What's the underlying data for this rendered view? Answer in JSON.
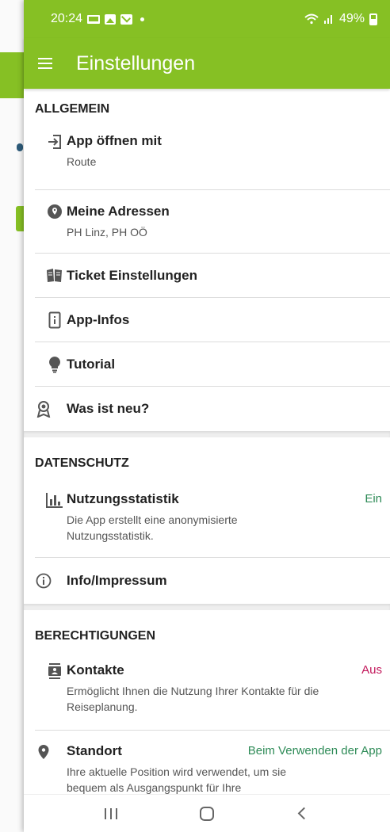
{
  "status_bar": {
    "time": "20:24",
    "battery": "49%"
  },
  "app_bar": {
    "title": "Einstellungen"
  },
  "sections": {
    "allgemein": {
      "header": "ALLGEMEIN",
      "items": [
        {
          "title": "App öffnen mit",
          "subtitle": "Route",
          "icon": "open-in-icon"
        },
        {
          "title": "Meine Adressen",
          "subtitle": "PH Linz, PH OÖ",
          "icon": "location-icon"
        },
        {
          "title": "Ticket Einstellungen",
          "icon": "ticket-icon"
        },
        {
          "title": "App-Infos",
          "icon": "phone-info-icon"
        },
        {
          "title": "Tutorial",
          "icon": "lightbulb-icon"
        },
        {
          "title": "Was ist neu?",
          "icon": "award-icon"
        }
      ]
    },
    "datenschutz": {
      "header": "DATENSCHUTZ",
      "items": [
        {
          "title": "Nutzungsstatistik",
          "value": "Ein",
          "subtitle": "Die App erstellt eine anonymisierte Nutzungsstatistik.",
          "icon": "bar-chart-icon"
        },
        {
          "title": "Info/Impressum",
          "icon": "info-icon"
        }
      ]
    },
    "berechtigungen": {
      "header": "BERECHTIGUNGEN",
      "items": [
        {
          "title": "Kontakte",
          "value": "Aus",
          "subtitle": "Ermöglicht Ihnen die Nutzung Ihrer Kontakte für die Reiseplanung.",
          "icon": "contacts-icon"
        },
        {
          "title": "Standort",
          "value": "Beim Verwenden der App",
          "subtitle": "Ihre aktuelle Position wird verwendet, um sie bequem als Ausgangspunkt für Ihre",
          "icon": "location-pin-icon"
        }
      ]
    }
  },
  "colors": {
    "brand": "#86c024",
    "on": "#2e8b57",
    "off": "#c2185b"
  }
}
